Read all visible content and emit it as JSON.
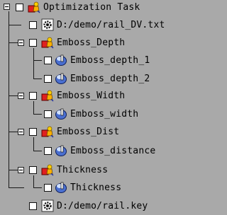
{
  "tree": {
    "root": {
      "label": "Optimization Task",
      "icon": "task-folder-icon"
    },
    "items": [
      {
        "label": "D:/demo/rail_DV.txt",
        "icon": "file-gear-icon"
      },
      {
        "label": "Emboss_Depth",
        "icon": "task-folder-icon",
        "children": [
          {
            "label": "Emboss_depth_1",
            "icon": "variable-icon"
          },
          {
            "label": "Emboss_depth_2",
            "icon": "variable-icon"
          }
        ]
      },
      {
        "label": "Emboss_Width",
        "icon": "task-folder-icon",
        "children": [
          {
            "label": "Emboss_width",
            "icon": "variable-icon"
          }
        ]
      },
      {
        "label": "Emboss_Dist",
        "icon": "task-folder-icon",
        "children": [
          {
            "label": "Emboss_distance",
            "icon": "variable-icon"
          }
        ]
      },
      {
        "label": "Thickness",
        "icon": "task-folder-icon",
        "children": [
          {
            "label": "Thickness",
            "icon": "variable-icon"
          }
        ]
      },
      {
        "label": "D:/demo/rail.key",
        "icon": "file-gear-icon"
      }
    ]
  }
}
